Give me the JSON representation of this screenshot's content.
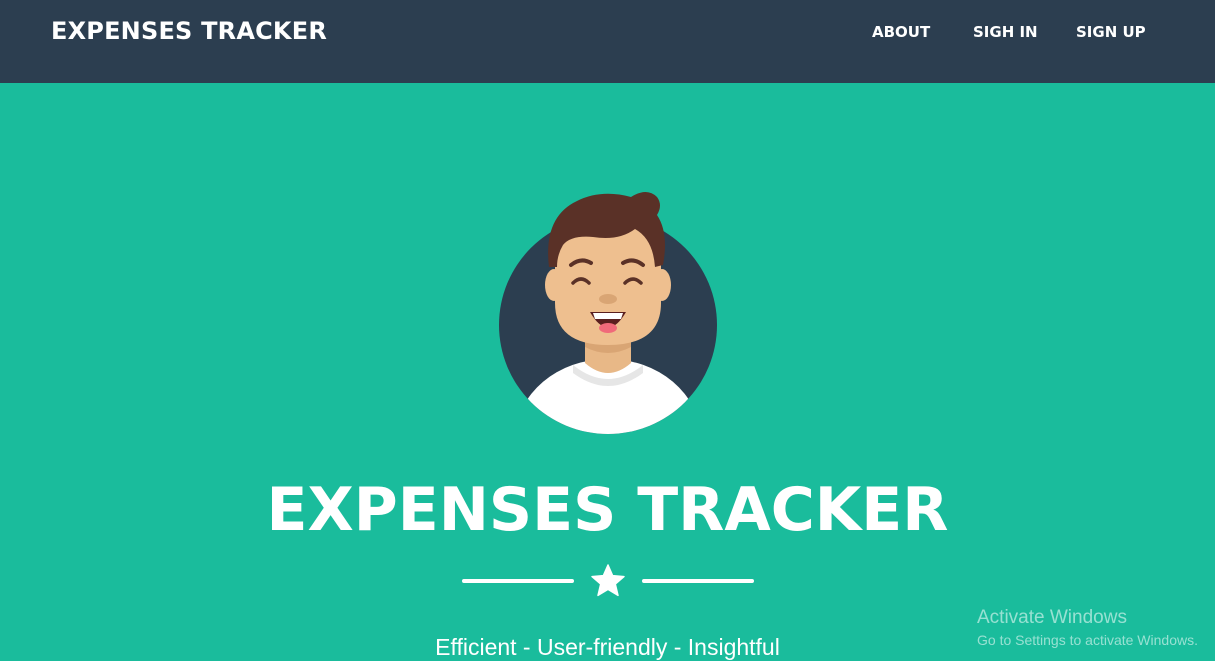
{
  "navbar": {
    "brand": "EXPENSES TRACKER",
    "links": [
      {
        "label": "ABOUT"
      },
      {
        "label": "SIGH IN"
      },
      {
        "label": "SIGN UP"
      }
    ]
  },
  "hero": {
    "avatar_icon": "smiling-man-avatar",
    "title": "EXPENSES TRACKER",
    "divider_icon": "star-icon",
    "subtitle": "Efficient - User-friendly - Insightful"
  },
  "watermark": {
    "title": "Activate Windows",
    "subtitle": "Go to Settings to activate Windows."
  },
  "colors": {
    "navbar_bg": "#2c3e50",
    "hero_bg": "#1abc9c",
    "text": "#ffffff"
  }
}
